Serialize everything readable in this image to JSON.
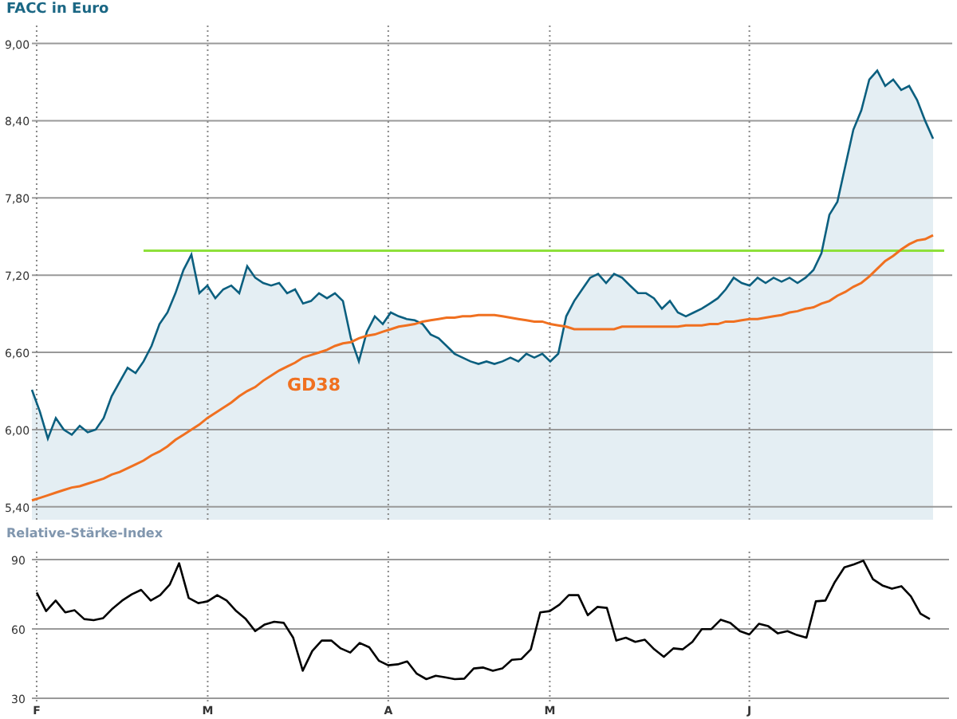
{
  "price_chart": {
    "title": "FACC in Euro",
    "chart_data": {
      "type": "area",
      "grid": true,
      "ylim": [
        5.3,
        9.14
      ],
      "yticks": [
        {
          "value": 9.0,
          "label": "9,00"
        },
        {
          "value": 8.4,
          "label": "8,40"
        },
        {
          "value": 7.8,
          "label": "7,80"
        },
        {
          "value": 7.2,
          "label": "7,20"
        },
        {
          "value": 6.6,
          "label": "6,60"
        },
        {
          "value": 6.0,
          "label": "6,00"
        },
        {
          "value": 5.4,
          "label": "5,40"
        }
      ],
      "series": [
        {
          "type": "area",
          "color": "#0b5f7f",
          "values": [
            6.31,
            6.14,
            5.93,
            6.09,
            6.0,
            5.96,
            6.03,
            5.98,
            6.0,
            6.09,
            6.26,
            6.37,
            6.48,
            6.44,
            6.53,
            6.65,
            6.82,
            6.91,
            7.06,
            7.24,
            7.36,
            7.06,
            7.12,
            7.02,
            7.09,
            7.12,
            7.06,
            7.27,
            7.18,
            7.14,
            7.12,
            7.14,
            7.06,
            7.09,
            6.98,
            7.0,
            7.06,
            7.02,
            7.06,
            7.0,
            6.71,
            6.53,
            6.76,
            6.88,
            6.82,
            6.91,
            6.88,
            6.86,
            6.85,
            6.82,
            6.74,
            6.71,
            6.65,
            6.59,
            6.56,
            6.53,
            6.51,
            6.53,
            6.51,
            6.53,
            6.56,
            6.53,
            6.59,
            6.56,
            6.59,
            6.53,
            6.59,
            6.88,
            7.0,
            7.09,
            7.18,
            7.21,
            7.14,
            7.21,
            7.18,
            7.12,
            7.06,
            7.06,
            7.02,
            6.94,
            7.0,
            6.91,
            6.88,
            6.91,
            6.94,
            6.98,
            7.02,
            7.09,
            7.18,
            7.14,
            7.12,
            7.18,
            7.14,
            7.18,
            7.15,
            7.18,
            7.14,
            7.18,
            7.24,
            7.37,
            7.67,
            7.77,
            8.05,
            8.33,
            8.48,
            8.72,
            8.79,
            8.67,
            8.72,
            8.64,
            8.67,
            8.56,
            8.4,
            8.26
          ]
        },
        {
          "type": "line",
          "color": "#f07020",
          "values": [
            5.45,
            5.47,
            5.49,
            5.51,
            5.53,
            5.55,
            5.56,
            5.58,
            5.6,
            5.62,
            5.65,
            5.67,
            5.7,
            5.73,
            5.76,
            5.8,
            5.83,
            5.87,
            5.92,
            5.96,
            6.0,
            6.04,
            6.09,
            6.13,
            6.17,
            6.21,
            6.26,
            6.3,
            6.33,
            6.38,
            6.42,
            6.46,
            6.49,
            6.52,
            6.56,
            6.58,
            6.6,
            6.62,
            6.65,
            6.67,
            6.68,
            6.71,
            6.73,
            6.74,
            6.76,
            6.78,
            6.8,
            6.81,
            6.82,
            6.84,
            6.85,
            6.86,
            6.87,
            6.87,
            6.88,
            6.88,
            6.89,
            6.89,
            6.89,
            6.88,
            6.87,
            6.86,
            6.85,
            6.84,
            6.84,
            6.82,
            6.81,
            6.8,
            6.78,
            6.78,
            6.78,
            6.78,
            6.78,
            6.78,
            6.8,
            6.8,
            6.8,
            6.8,
            6.8,
            6.8,
            6.8,
            6.8,
            6.81,
            6.81,
            6.81,
            6.82,
            6.82,
            6.84,
            6.84,
            6.85,
            6.86,
            6.86,
            6.87,
            6.88,
            6.89,
            6.91,
            6.92,
            6.94,
            6.95,
            6.98,
            7.0,
            7.04,
            7.07,
            7.11,
            7.14,
            7.19,
            7.25,
            7.31,
            7.35,
            7.4,
            7.44,
            7.47,
            7.48,
            7.51
          ]
        }
      ],
      "ref_lines": [
        {
          "axis": "y",
          "value": 7.39,
          "color": "#8ee03a"
        }
      ],
      "annotations": [
        "GD38"
      ]
    }
  },
  "rsi_chart": {
    "title": "Relative-Stärke-Index",
    "chart_data": {
      "type": "line",
      "grid": true,
      "ylim": [
        30,
        90
      ],
      "ref_lines": [
        {
          "axis": "y",
          "value": 60,
          "color": "#999999"
        }
      ],
      "yticks": [
        30,
        60,
        90
      ],
      "categories": [
        "F",
        null,
        null,
        null,
        null,
        null,
        null,
        null,
        null,
        null,
        null,
        null,
        null,
        null,
        null,
        null,
        null,
        null,
        "M",
        null,
        null,
        null,
        null,
        null,
        null,
        null,
        null,
        null,
        null,
        null,
        null,
        null,
        null,
        null,
        null,
        null,
        null,
        "A",
        null,
        null,
        null,
        null,
        null,
        null,
        null,
        null,
        null,
        null,
        null,
        null,
        null,
        null,
        null,
        null,
        "M",
        null,
        null,
        null,
        null,
        null,
        null,
        null,
        null,
        null,
        null,
        null,
        null,
        null,
        null,
        null,
        null,
        null,
        null,
        null,
        null,
        "J",
        null,
        null,
        null,
        null,
        null,
        null,
        null,
        null,
        null,
        null,
        null,
        null,
        null,
        null,
        null,
        null,
        null,
        null,
        null
      ],
      "series": [
        {
          "color": "#000000",
          "values": [
            75.7,
            67.7,
            72.3,
            67.2,
            68.1,
            64.3,
            63.8,
            64.7,
            68.8,
            72.3,
            75.0,
            76.9,
            72.3,
            74.6,
            79.2,
            88.4,
            73.4,
            71.2,
            71.9,
            74.6,
            72.3,
            67.7,
            64.3,
            59.0,
            61.9,
            63.1,
            62.6,
            56.2,
            41.9,
            50.5,
            55.0,
            55.0,
            51.6,
            49.8,
            53.9,
            52.1,
            46.3,
            44.3,
            44.7,
            45.9,
            40.6,
            38.3,
            39.7,
            39.0,
            38.3,
            38.5,
            42.9,
            43.3,
            41.9,
            42.9,
            46.6,
            47.0,
            51.2,
            67.2,
            67.7,
            70.5,
            74.6,
            74.6,
            65.9,
            69.5,
            69.1,
            55.0,
            56.2,
            54.4,
            55.3,
            51.2,
            47.9,
            51.6,
            51.2,
            54.4,
            59.9,
            59.9,
            64.0,
            62.6,
            59.0,
            57.6,
            62.2,
            61.2,
            58.1,
            59.0,
            57.4,
            56.2,
            71.9,
            72.3,
            80.3,
            86.6,
            87.9,
            89.5,
            81.5,
            78.8,
            77.4,
            78.5,
            74.1,
            66.6,
            64.3
          ]
        }
      ]
    }
  }
}
